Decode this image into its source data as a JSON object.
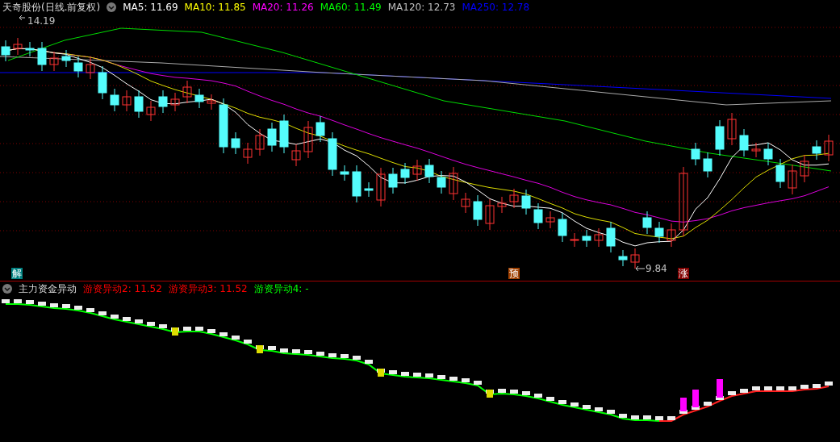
{
  "header": {
    "title": "天奇股份(日线.前复权)",
    "legend": [
      {
        "label": "MA5: 11.69",
        "color": "#ffffff"
      },
      {
        "label": "MA10: 11.85",
        "color": "#ffff00"
      },
      {
        "label": "MA20: 11.26",
        "color": "#ff00ff"
      },
      {
        "label": "MA60: 11.49",
        "color": "#00ff00"
      },
      {
        "label": "MA120: 12.73",
        "color": "#c0c0c0"
      },
      {
        "label": "MA250: 12.78",
        "color": "#0000ff"
      }
    ]
  },
  "price_chart": {
    "high_label": "14.19",
    "low_label": "9.84",
    "markers": [
      {
        "label": "解",
        "color": "#008080"
      },
      {
        "label": "预",
        "color": "#a04000"
      },
      {
        "label": "涨",
        "color": "#800000"
      }
    ]
  },
  "indicator": {
    "title": "主力资金异动",
    "legend": [
      {
        "label": "游资异动2: 11.52",
        "color": "#ff0000"
      },
      {
        "label": "游资异动3: 11.52",
        "color": "#ff0000"
      },
      {
        "label": "游资异动4: -",
        "color": "#00ff00"
      }
    ]
  }
}
